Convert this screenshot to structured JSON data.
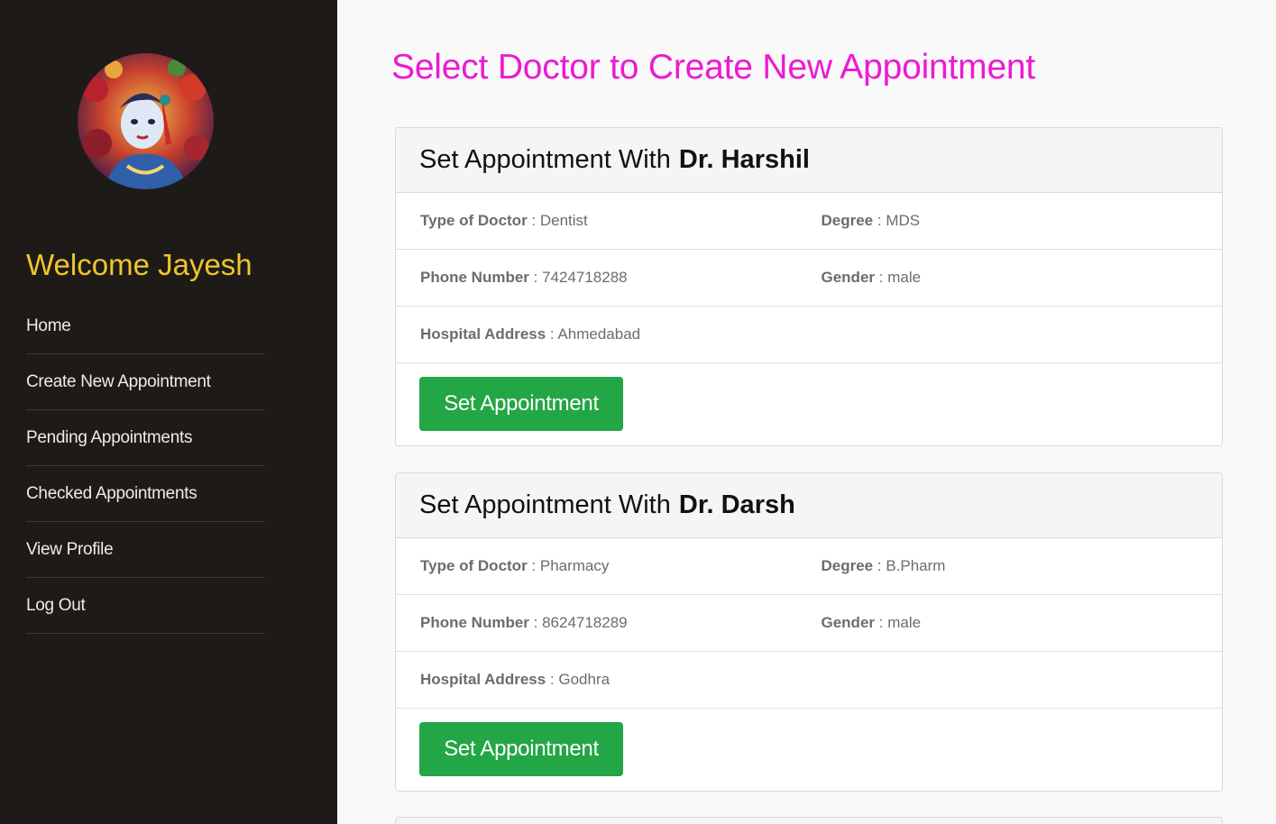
{
  "sidebar": {
    "welcome": "Welcome Jayesh",
    "nav": [
      {
        "label": "Home"
      },
      {
        "label": "Create New Appointment"
      },
      {
        "label": "Pending Appointments"
      },
      {
        "label": "Checked Appointments"
      },
      {
        "label": "View Profile"
      },
      {
        "label": "Log Out"
      }
    ]
  },
  "main": {
    "title": "Select Doctor to Create New Appointment",
    "doctors": [
      {
        "header_prefix": "Set Appointment With",
        "name": "Dr. Harshil",
        "type_label": "Type of Doctor",
        "type": "Dentist",
        "degree_label": "Degree",
        "degree": "MDS",
        "phone_label": "Phone Number",
        "phone": "7424718288",
        "gender_label": "Gender",
        "gender": "male",
        "address_label": "Hospital Address",
        "address": "Ahmedabad",
        "button": "Set Appointment"
      },
      {
        "header_prefix": "Set Appointment With",
        "name": "Dr. Darsh",
        "type_label": "Type of Doctor",
        "type": "Pharmacy",
        "degree_label": "Degree",
        "degree": "B.Pharm",
        "phone_label": "Phone Number",
        "phone": "8624718289",
        "gender_label": "Gender",
        "gender": "male",
        "address_label": "Hospital Address",
        "address": "Godhra",
        "button": "Set Appointment"
      }
    ]
  },
  "colors": {
    "sidebar_bg": "#1e1a18",
    "welcome": "#f0c52a",
    "title": "#ec1ad3",
    "button": "#23a645"
  }
}
